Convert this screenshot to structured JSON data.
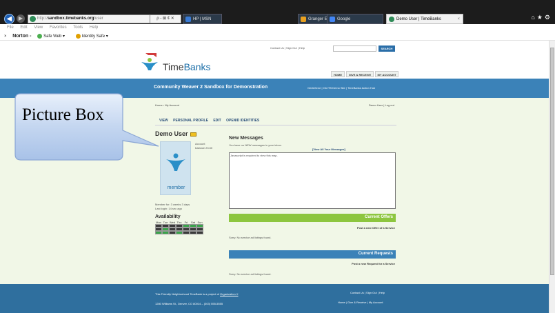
{
  "browser": {
    "address_prefix": "http://",
    "address_domain": "sandbox.timebanks.org",
    "address_suffix": "/user",
    "address_tools": "ρ - ⊠ ¢ ✕",
    "tabs": [
      {
        "label": "HP | MSN",
        "icon_color": "#3a7bd5"
      },
      {
        "label": "Granger Engineering Library - ...",
        "icon_color": "#e8a020"
      },
      {
        "label": "Google",
        "icon_color": "#4285f4"
      },
      {
        "label": "Demo User | TimeBanks",
        "icon_color": "#2e8b57",
        "active": true
      }
    ],
    "menu": [
      "File",
      "Edit",
      "View",
      "Favorites",
      "Tools",
      "Help"
    ],
    "toolbar": {
      "close": "×",
      "norton": "Norton -",
      "safe_web": "Safe Web ▾",
      "identity_safe": "Identity Safe ▾"
    }
  },
  "site": {
    "logo_text_a": "Time",
    "logo_text_b": "Banks",
    "top_links": "Contact Us  |  Sign Out  |  Help",
    "search_label": "SEARCH",
    "header_tabs": [
      "HOME",
      "GIVE & RECEIVE",
      "MY ACCOUNT"
    ],
    "banner_title": "Community Weaver 2 Sandbox for Demonstration",
    "banner_links": "GeekGene  |  Old TB Demo Site  |  TimeBanks Action Hub"
  },
  "page": {
    "breadcrumb": "Home › My Account",
    "user_links": "Demo User | Log out",
    "subtabs": [
      "VIEW",
      "PERSONAL PROFILE",
      "EDIT",
      "OPENID IDENTITIES"
    ],
    "user_name": "Demo User",
    "member_label": "member",
    "account_label": "Account",
    "account_balance": "balance 23.50",
    "member_for": "Member for: 3 weeks 3 days",
    "last_login": "Last login: 14 sec ago",
    "availability_title": "Availability",
    "availability_days": [
      "Mon",
      "Tue",
      "Wed",
      "Thu",
      "Fri",
      "Sat",
      "Sun"
    ],
    "availability_grid": [
      [
        0,
        0,
        0,
        0,
        1,
        1,
        1
      ],
      [
        0,
        1,
        0,
        0,
        0,
        0,
        0
      ],
      [
        1,
        1,
        0,
        1,
        0,
        0,
        0
      ]
    ],
    "new_messages_title": "New Messages",
    "new_messages_text": "You have no NEW messages in your inbox.",
    "view_all_messages": "[View All Your Messages]",
    "map_text": "Javascript is required to view this map.",
    "current_offers_title": "Current Offers",
    "post_offer": "Post a new Offer of a Service",
    "offers_empty": "Sorry. No service ad listings found.",
    "current_requests_title": "Current Requests",
    "post_request": "Post a new Request for a Service",
    "requests_empty": "Sorry. No service ad listings found."
  },
  "footer": {
    "line1_prefix": "This Friendly Neighborhood TimeBank is a project of ",
    "line1_link": "Organization X",
    "line2": "1280 Williams St., Denver, CO 80014 – (303) 555-5555",
    "right1": "Contact Us  |  Sign Out  |  Help",
    "right2": "Home  |  Give & Receive  |  My Account"
  },
  "callout": {
    "text": "Picture Box"
  },
  "colors": {
    "accent_blue": "#3b82b8",
    "accent_green": "#8dc63f",
    "content_bg": "#f1f7e7"
  }
}
